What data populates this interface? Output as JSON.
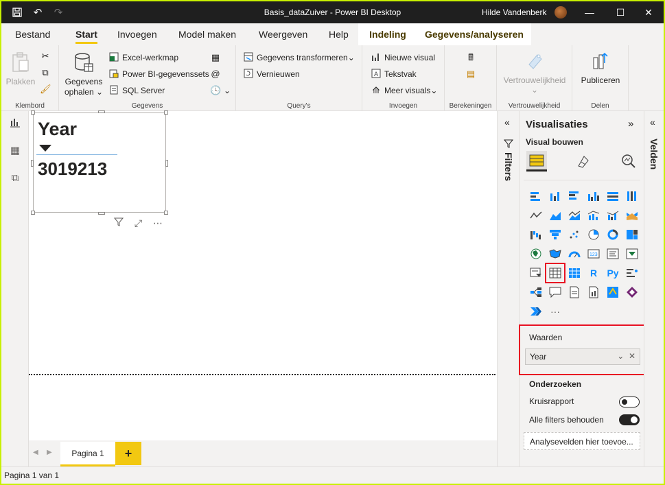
{
  "window": {
    "title": "Basis_dataZuiver - Power BI Desktop",
    "user": "Hilde Vandenberk",
    "minimize": "—",
    "maximize": "☐",
    "close": "✕"
  },
  "tabs": [
    {
      "label": "Bestand"
    },
    {
      "label": "Start"
    },
    {
      "label": "Invoegen"
    },
    {
      "label": "Model maken"
    },
    {
      "label": "Weergeven"
    },
    {
      "label": "Help"
    },
    {
      "label": "Indeling"
    },
    {
      "label": "Gegevens/analyseren"
    }
  ],
  "ribbon": {
    "klembord": {
      "label": "Klembord",
      "plakken": "Plakken"
    },
    "gegevens": {
      "label": "Gegevens",
      "ophalen_line1": "Gegevens",
      "ophalen_line2": "ophalen",
      "excel": "Excel-werkmap",
      "pbi": "Power BI-gegevenssets",
      "sql": "SQL Server"
    },
    "querys": {
      "label": "Query's",
      "transformeren": "Gegevens transformeren",
      "vernieuwen": "Vernieuwen"
    },
    "invoegen": {
      "label": "Invoegen",
      "nieuwe_visual": "Nieuwe visual",
      "tekstvak": "Tekstvak",
      "meer_visuals": "Meer visuals"
    },
    "berekeningen": {
      "label": "Berekeningen"
    },
    "vertrouwelijkheid": {
      "label": "Vertrouwelijkheid",
      "button": "Vertrouwelijkheid"
    },
    "delen": {
      "label": "Delen",
      "publiceren": "Publiceren"
    }
  },
  "card": {
    "title": "Year",
    "value": "3019213"
  },
  "pages": {
    "tab": "Pagina 1",
    "add": "+",
    "status": "Pagina 1 van 1"
  },
  "filters": {
    "label": "Filters"
  },
  "visualisaties": {
    "title": "Visualisaties",
    "visual_bouwen": "Visual bouwen",
    "r_label": "R",
    "py_label": "Py",
    "more": "···",
    "waarden_label": "Waarden",
    "waarden_field": "Year",
    "onderzoeken": "Onderzoeken",
    "kruisrapport": "Kruisrapport",
    "kruisrapport_on": false,
    "alle_filters": "Alle filters behouden",
    "alle_filters_on": true,
    "analysevelden": "Analysevelden hier toevoe..."
  },
  "velden": {
    "label": "Velden"
  },
  "colors": {
    "accent": "#f2c811",
    "highlight": "#e81123",
    "frame": "#c8f000"
  }
}
